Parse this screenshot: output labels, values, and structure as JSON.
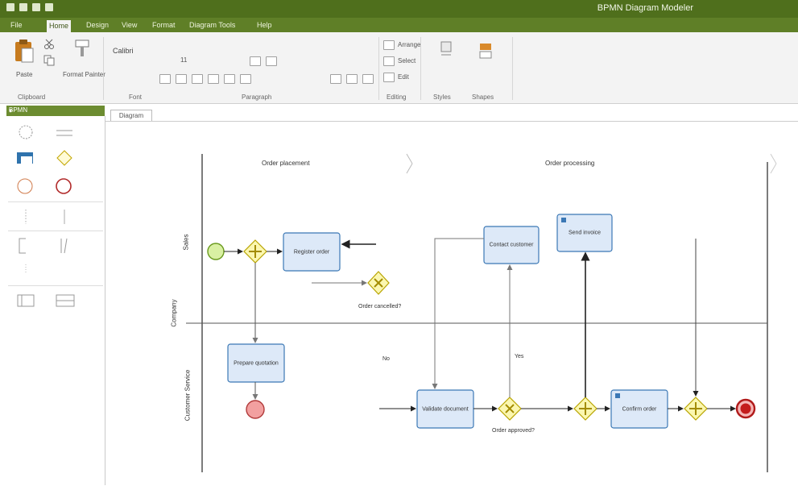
{
  "window": {
    "title": "BPMN Diagram Modeler"
  },
  "menu": {
    "tabs": [
      "File",
      "Home",
      "Design",
      "View",
      "Format",
      "Diagram Tools",
      "Help"
    ],
    "active_index": 1
  },
  "ribbon": {
    "paste_label": "Paste",
    "format_painter_label": "Format Painter",
    "font_name": "Calibri",
    "font_size": "11",
    "arrange_label": "Arrange",
    "select_label": "Select",
    "edit_label": "Edit",
    "groups": {
      "clipboard": "Clipboard",
      "font": "Font",
      "paragraph": "Paragraph",
      "editing": "Editing",
      "styles": "Styles",
      "shapes": "Shapes"
    }
  },
  "left_panel": {
    "title": "BPMN"
  },
  "document": {
    "tab_label": "Diagram"
  },
  "diagram": {
    "pool_label": "Company",
    "lanes": [
      "Sales",
      "Customer Service"
    ],
    "phases": [
      "Order placement",
      "Order processing"
    ],
    "tasks": {
      "register": "Register order",
      "prepare": "Prepare quotation",
      "customer": "Contact customer",
      "send": "Send invoice",
      "validate": "Validate document",
      "confirm": "Confirm order"
    },
    "labels": {
      "cancel_gateway": "Order cancelled?",
      "decision_gateway": "Order approved?",
      "yes": "Yes",
      "no": "No"
    }
  }
}
